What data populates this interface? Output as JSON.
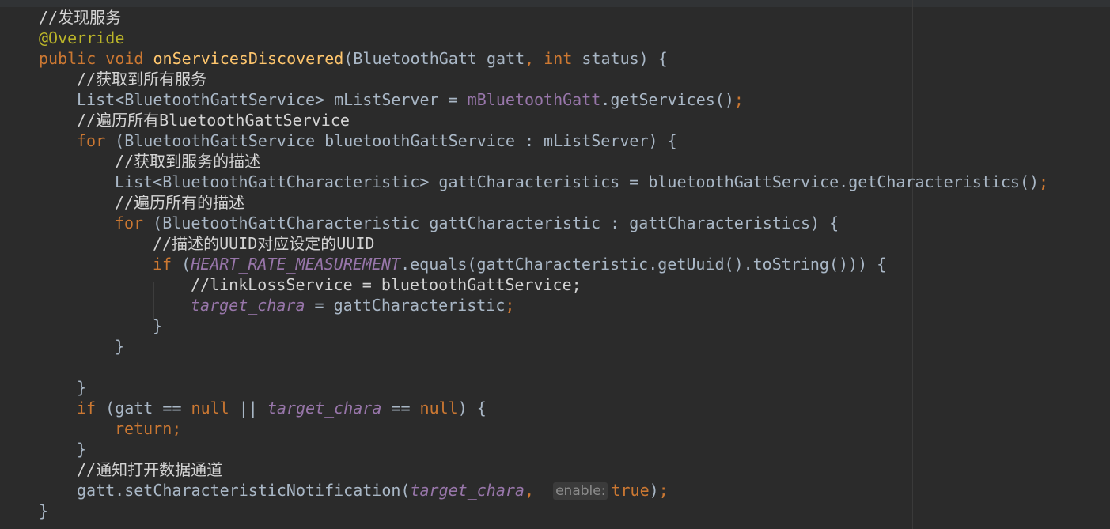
{
  "editor": {
    "comments": {
      "discover_services": "//发现服务",
      "get_all_services": "//获取到所有服务",
      "iterate_services": "//遍历所有BluetoothGattService",
      "get_service_descriptors": "//获取到服务的描述",
      "iterate_descriptors": "//遍历所有的描述",
      "uuid_match": "//描述的UUID对应设定的UUID",
      "link_loss": "//linkLossService = bluetoothGattService;",
      "enable_notify": "//通知打开数据通道"
    },
    "tokens": {
      "annotation": "@Override",
      "kw_public": "public",
      "kw_void": "void",
      "method_name": "onServicesDiscovered",
      "type_gatt": "BluetoothGatt",
      "param_gatt": "gatt",
      "kw_int": "int",
      "param_status": "status",
      "type_list": "List",
      "type_service": "BluetoothGattService",
      "var_list_server": "mListServer",
      "field_bt_gatt": "mBluetoothGatt",
      "call_get_services": "getServices()",
      "kw_for": "for",
      "var_service": "bluetoothGattService",
      "type_characteristic": "BluetoothGattCharacteristic",
      "var_characteristics": "gattCharacteristics",
      "call_get_characteristics": "getCharacteristics()",
      "var_characteristic": "gattCharacteristic",
      "kw_if": "if",
      "const_heart_rate": "HEART_RATE_MEASUREMENT",
      "call_equals_start": "equals(",
      "call_get_uuid": "getUuid().toString()",
      "field_target_chara": "target_chara",
      "kw_null": "null",
      "kw_return": "return",
      "call_set_notification": "setCharacteristicNotification(",
      "hint_enable": "enable:",
      "kw_true": "true"
    }
  }
}
